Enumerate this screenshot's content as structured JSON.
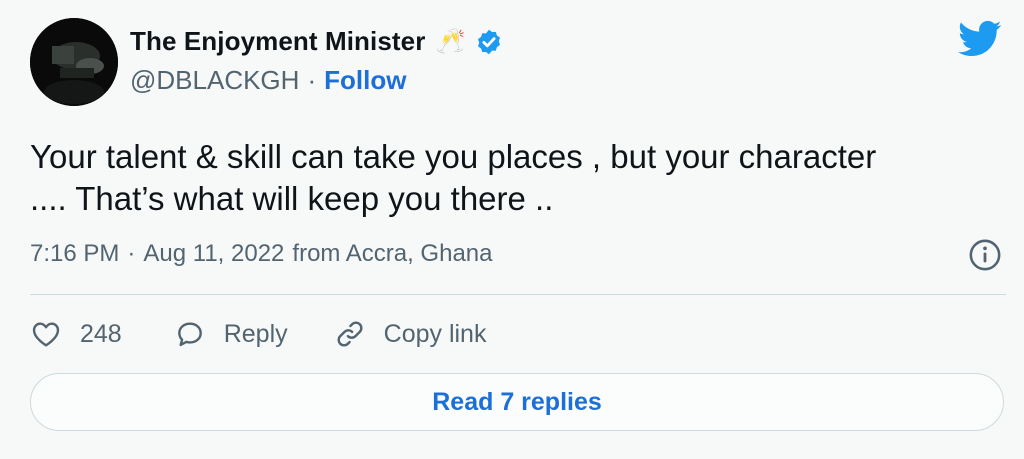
{
  "user": {
    "display_name": "The Enjoyment Minister",
    "emoji": "🥂",
    "handle": "@DBLACKGH",
    "separator": "·",
    "follow_label": "Follow"
  },
  "tweet": {
    "text": "Your talent & skill can take you places , but your character\n.... That’s what will keep you there ..",
    "time": "7:16 PM",
    "date": "Aug 11, 2022",
    "location": "from Accra, Ghana"
  },
  "actions": {
    "like_count": "248",
    "reply_label": "Reply",
    "copy_link_label": "Copy link"
  },
  "read_replies_label": "Read 7 replies",
  "colors": {
    "accent": "#1d9bf0",
    "link": "#1d6fd8",
    "muted": "#536471",
    "background": "#f7f9f9"
  },
  "icons": [
    "twitter-logo-icon",
    "verified-badge-icon",
    "info-icon",
    "heart-icon",
    "reply-icon",
    "link-icon"
  ]
}
